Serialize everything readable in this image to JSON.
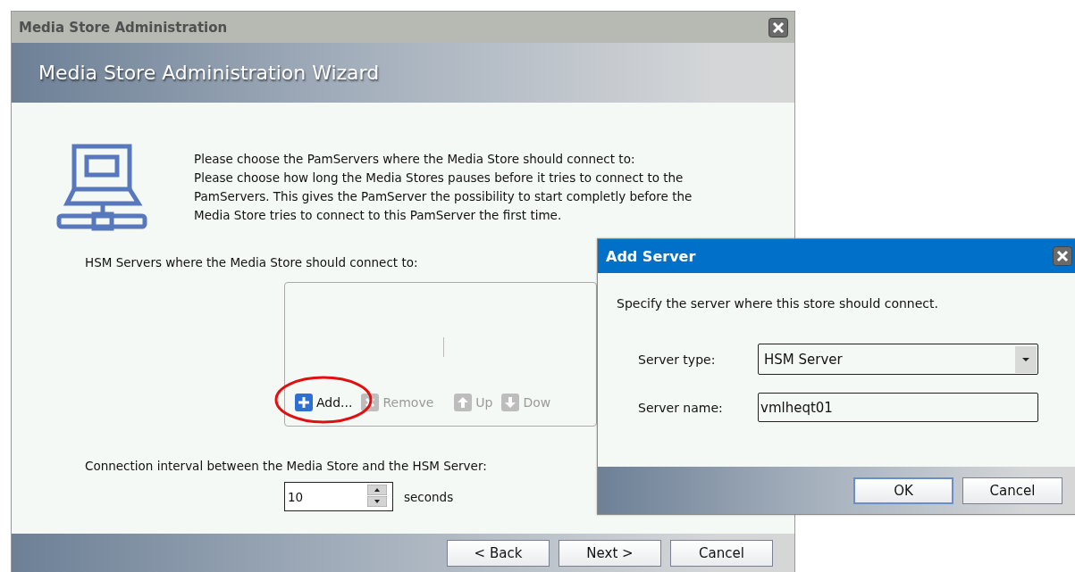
{
  "window": {
    "title": "Media Store Administration"
  },
  "wizard_header": {
    "title": "Media Store Administration Wizard"
  },
  "instructions": {
    "heading": "Please choose the PamServers where the Media Store should connect to:",
    "text": "Please choose how long the Media Stores pauses before it tries to connect to the PamServers. This gives the PamServer the possibility to start completly before the Media Store tries to connect to this PamServer the first time."
  },
  "servers_label": "HSM Servers where the Media Store should connect to:",
  "server_list": {
    "toolbar": [
      {
        "kind": "add",
        "label": "Add...",
        "disabled": false,
        "separator_before": false
      },
      {
        "kind": "remove",
        "label": "Remove",
        "disabled": true,
        "separator_before": false
      },
      {
        "kind": "up",
        "label": "Up",
        "disabled": true,
        "separator_before": true
      },
      {
        "kind": "down",
        "label": "Dow",
        "disabled": true,
        "separator_before": false
      }
    ]
  },
  "interval": {
    "label": "Connection interval between the Media Store and the HSM Server:",
    "value": "10",
    "unit": "seconds"
  },
  "buttons": [
    "< Back",
    "Next >",
    "Cancel"
  ],
  "dialog": {
    "title": "Add Server",
    "instruction": "Specify the server where this store should connect.",
    "fields": [
      {
        "kind": "dropdown",
        "label": "Server type:",
        "value": "HSM Server"
      },
      {
        "kind": "text",
        "label": "Server name:",
        "value": "vmlheqt01"
      }
    ],
    "buttons": [
      {
        "label": "OK",
        "default": true
      },
      {
        "label": "Cancel",
        "default": false
      }
    ]
  }
}
